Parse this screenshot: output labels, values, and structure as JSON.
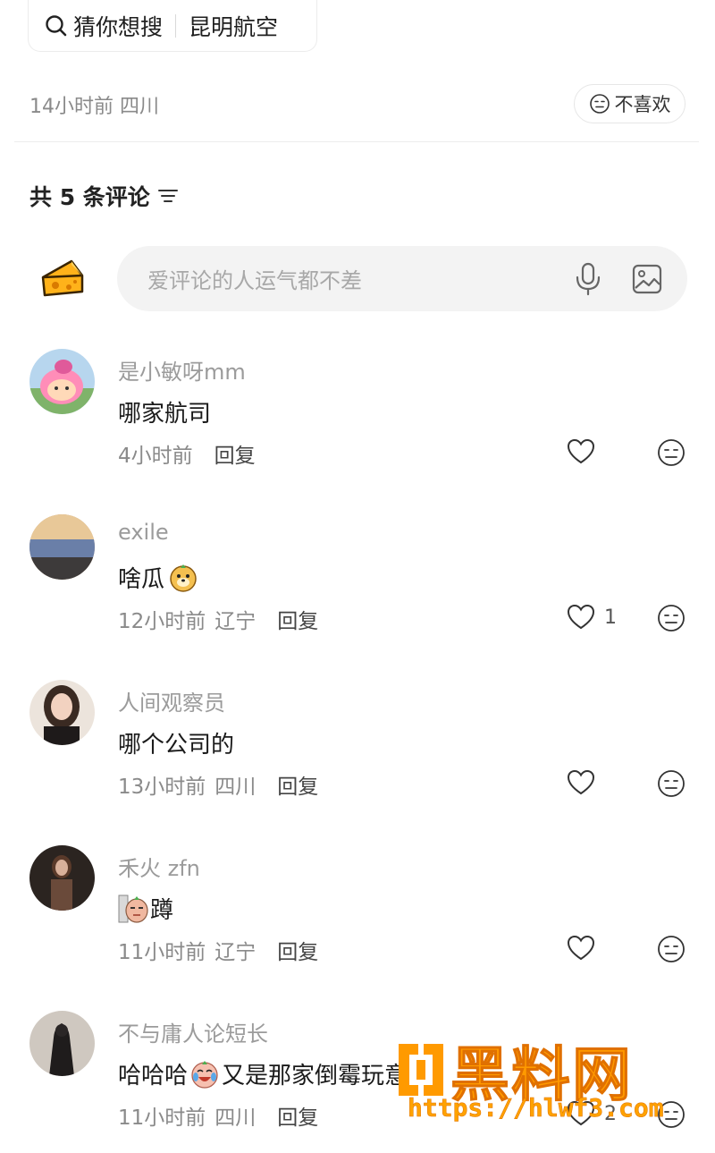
{
  "search": {
    "label": "猜你想搜",
    "suggestion": "昆明航空"
  },
  "post_meta": {
    "time_location": "14小时前 四川"
  },
  "dislike_button": {
    "label": "不喜欢"
  },
  "comments_header": {
    "title": "共 5 条评论"
  },
  "comment_input": {
    "placeholder": "爱评论的人运气都不差"
  },
  "comments": [
    {
      "user": "是小敏呀mm",
      "text": "哪家航司",
      "emoji": "",
      "time": "4小时前",
      "location": "",
      "reply": "回复",
      "likes": ""
    },
    {
      "user": "exile",
      "text": "啥瓜",
      "emoji": "dog-emoji",
      "time": "12小时前",
      "location": "辽宁",
      "reply": "回复",
      "likes": "1"
    },
    {
      "user": "人间观察员",
      "text": "哪个公司的",
      "emoji": "",
      "time": "13小时前",
      "location": "四川",
      "reply": "回复",
      "likes": ""
    },
    {
      "user": "禾火 zfn",
      "text": "蹲",
      "emoji": "peek-emoji",
      "time": "11小时前",
      "location": "辽宁",
      "reply": "回复",
      "likes": ""
    },
    {
      "user": "不与庸人论短长",
      "text_before": "哈哈哈",
      "text_after": "又是那家倒霉玩意",
      "emoji": "crying-laugh-emoji",
      "time": "11小时前",
      "location": "四川",
      "reply": "回复",
      "likes": "2"
    }
  ],
  "watermark": {
    "text": "黑料网",
    "url": "https://hlwf3.com"
  },
  "colors": {
    "accent_watermark": "#ff9a00",
    "meta_gray": "#8a8a8a",
    "input_bg": "#f3f3f3"
  }
}
